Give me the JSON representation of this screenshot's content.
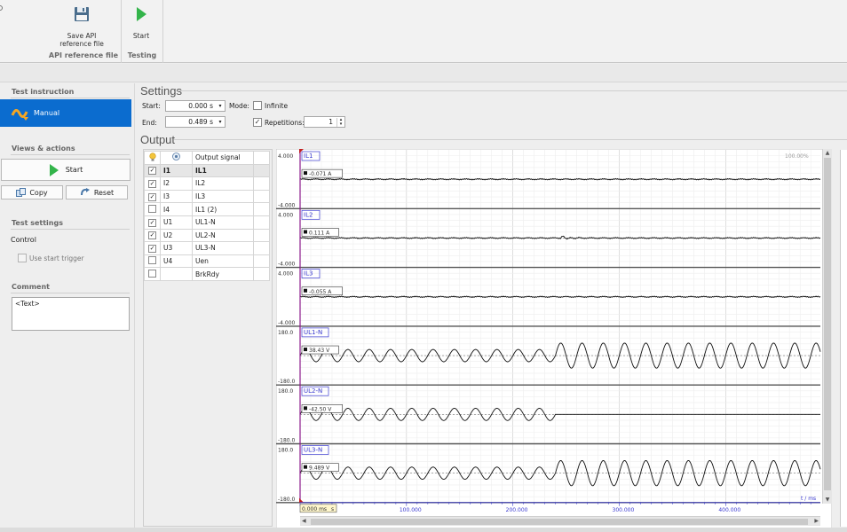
{
  "ribbon": {
    "save_label": "Save API reference file",
    "save_label_l1": "Save API",
    "save_label_l2": "reference file",
    "start_label": "Start",
    "group_api": "API reference file",
    "group_testing": "Testing"
  },
  "left": {
    "test_instruction": "Test instruction",
    "manual": "Manual",
    "views_actions": "Views & actions",
    "start": "Start",
    "copy": "Copy",
    "reset": "Reset",
    "test_settings": "Test settings",
    "control": "Control",
    "use_start_trigger": "Use start trigger",
    "comment": "Comment",
    "comment_text": "<Text>"
  },
  "settings": {
    "title": "Settings",
    "start_label": "Start:",
    "start_value": "0.000 s",
    "end_label": "End:",
    "end_value": "0.489 s",
    "mode_label": "Mode:",
    "infinite_label": "Infinite",
    "infinite_checked": false,
    "repetitions_label": "Repetitions:",
    "repetitions_checked": true,
    "repetitions_value": "1"
  },
  "output": {
    "title": "Output",
    "header_signal": "Output signal",
    "rows": [
      {
        "checked": true,
        "id": "I1",
        "signal": "IL1",
        "selected": true
      },
      {
        "checked": true,
        "id": "I2",
        "signal": "IL2",
        "selected": false
      },
      {
        "checked": true,
        "id": "I3",
        "signal": "IL3",
        "selected": false
      },
      {
        "checked": false,
        "id": "I4",
        "signal": "IL1 (2)",
        "selected": false
      },
      {
        "checked": true,
        "id": "U1",
        "signal": "UL1-N",
        "selected": false
      },
      {
        "checked": true,
        "id": "U2",
        "signal": "UL2-N",
        "selected": false
      },
      {
        "checked": true,
        "id": "U3",
        "signal": "UL3-N",
        "selected": false
      },
      {
        "checked": false,
        "id": "U4",
        "signal": "Uen",
        "selected": false
      },
      {
        "checked": false,
        "id": "",
        "signal": "BrkRdy",
        "selected": false
      }
    ]
  },
  "chart_data": {
    "type": "line",
    "zoom": "100.00%",
    "cursor_readout": "0.000 ms",
    "cursor_unit": "s",
    "x_unit": "t / ms",
    "xlim": [
      0,
      489
    ],
    "x_ticks": [
      "100.000",
      "200.000",
      "300.000",
      "400.000"
    ],
    "tick_values": [
      100,
      200,
      300,
      400
    ],
    "traces": [
      {
        "name": "IL1",
        "value_label": "-0.071 A",
        "y_top": "4.000",
        "y_bottom": "-4.000",
        "ylim": [
          -4,
          4
        ],
        "kind": "flat",
        "amp_before": 0.06,
        "amp_after": 0.06,
        "change_ms": 240
      },
      {
        "name": "IL2",
        "value_label": "0.111 A",
        "y_top": "4.000",
        "y_bottom": "-4.000",
        "ylim": [
          -4,
          4
        ],
        "kind": "glitch",
        "amp_before": 0.06,
        "amp_after": 0.06,
        "change_ms": 240
      },
      {
        "name": "IL3",
        "value_label": "-0.055 A",
        "y_top": "4.000",
        "y_bottom": "-4.000",
        "ylim": [
          -4,
          4
        ],
        "kind": "flat",
        "amp_before": 0.06,
        "amp_after": 0.06,
        "change_ms": 240
      },
      {
        "name": "UL1-N",
        "value_label": "38.43 V",
        "y_top": "180.0",
        "y_bottom": "-180.0",
        "ylim": [
          -180,
          180
        ],
        "kind": "sine",
        "amp_before": 40,
        "amp_after": 82,
        "change_ms": 240
      },
      {
        "name": "UL2-N",
        "value_label": "-42.50 V",
        "y_top": "180.0",
        "y_bottom": "-180.0",
        "ylim": [
          -180,
          180
        ],
        "kind": "sine",
        "amp_before": 40,
        "amp_after": 0,
        "change_ms": 240
      },
      {
        "name": "UL3-N",
        "value_label": "9.489 V",
        "y_top": "180.0",
        "y_bottom": "-180.0",
        "ylim": [
          -180,
          180
        ],
        "kind": "sine",
        "amp_before": 40,
        "amp_after": 82,
        "change_ms": 240
      }
    ],
    "frequency_hz": 50
  },
  "colors": {
    "selection": "#0b6ccf",
    "start_green": "#33b44a",
    "cursor": "#8b1a8b",
    "label_blue": "#3a3ad0"
  }
}
